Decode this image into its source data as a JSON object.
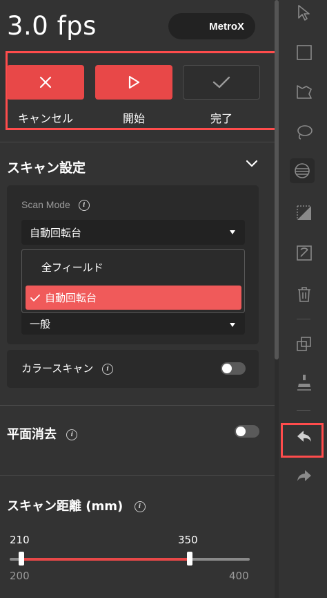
{
  "header": {
    "fps": "3.0 fps",
    "device": "MetroX"
  },
  "actions": [
    {
      "label": "キャンセル",
      "icon": "close-icon"
    },
    {
      "label": "開始",
      "icon": "play-icon"
    },
    {
      "label": "完了",
      "icon": "check-icon"
    }
  ],
  "scan_settings": {
    "title": "スキャン設定",
    "scan_mode_label": "Scan Mode",
    "scan_mode_value": "自動回転台",
    "options": [
      "全フィールド",
      "自動回転台"
    ],
    "selected_option": "自動回転台",
    "second_select_value": "一般",
    "color_scan_label": "カラースキャン",
    "color_scan_on": false
  },
  "plane_removal": {
    "label": "平面消去",
    "on": false
  },
  "scan_distance": {
    "title": "スキャン距離 (mm)",
    "low_value": "210",
    "high_value": "350",
    "min_label": "200",
    "max_label": "400",
    "min": 200,
    "max": 400,
    "low": 210,
    "high": 350
  },
  "toolbar": {
    "tools": [
      "cursor-icon",
      "rectangle-select-icon",
      "lasso-select-icon",
      "freeform-select-icon",
      "select-through-icon",
      "invert-select-icon",
      "hide-icon",
      "delete-icon",
      "duplicate-icon",
      "clean-brush-icon",
      "undo-icon",
      "redo-icon"
    ]
  },
  "colors": {
    "accent": "#e84848",
    "highlight": "#ff4c4c",
    "panel": "#333333"
  }
}
